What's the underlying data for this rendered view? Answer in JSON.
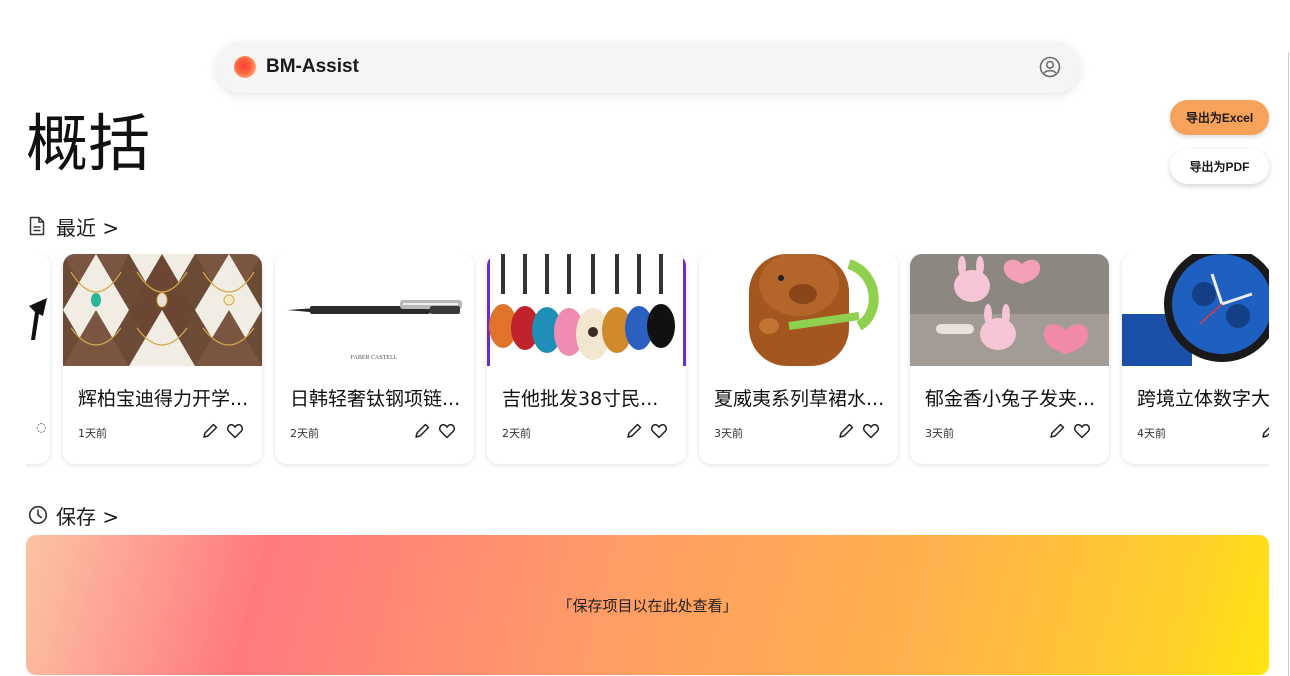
{
  "app": {
    "name": "BM-Assist"
  },
  "page": {
    "title": "概括"
  },
  "actions": {
    "export_excel": "导出为Excel",
    "export_pdf": "导出为PDF"
  },
  "sections": {
    "recent": {
      "label": "最近 >",
      "icon": "document-icon"
    },
    "saved": {
      "label": "保存 >",
      "icon": "clock-icon",
      "empty_message": "「保存项目以在此处查看」"
    }
  },
  "recent_items": [
    {
      "title": "",
      "time": ""
    },
    {
      "title": "辉柏宝迪得力开学...",
      "time": "1天前"
    },
    {
      "title": "日韩轻奢钛钢项链...",
      "time": "2天前"
    },
    {
      "title": "吉他批发38寸民...",
      "time": "2天前"
    },
    {
      "title": "夏威夷系列草裙水...",
      "time": "3天前"
    },
    {
      "title": "郁金香小兔子发夹...",
      "time": "3天前"
    },
    {
      "title": "跨境立体数字大",
      "time": "4天前"
    }
  ],
  "thumb_text": {
    "pen_brand": "FABER CASTELL"
  },
  "colors": {
    "accent": "#f7a25a"
  }
}
